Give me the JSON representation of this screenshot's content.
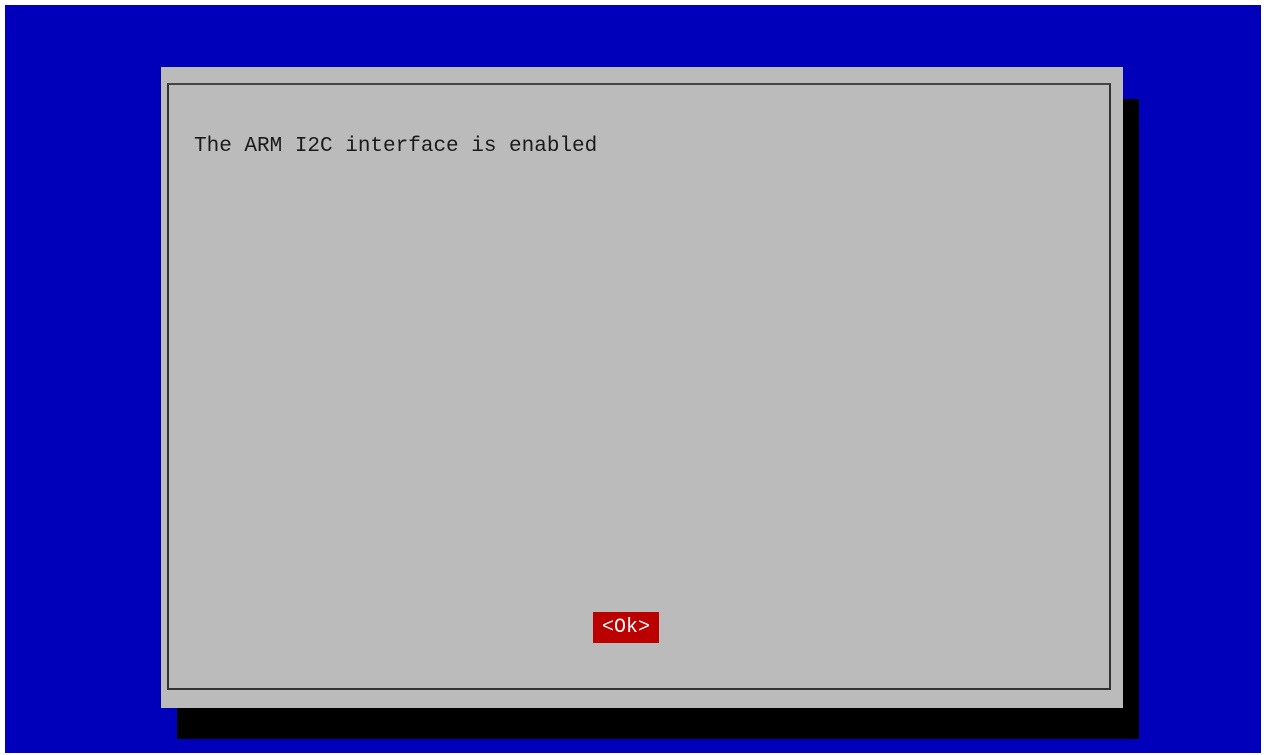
{
  "dialog": {
    "message": "The ARM I2C interface is enabled",
    "ok_label": "<Ok>"
  },
  "colors": {
    "background": "#0000bb",
    "dialog": "#bbbbbb",
    "shadow": "#000000",
    "button_focus": "#bb0000",
    "button_text": "#ffffff",
    "text": "#1a1a1a"
  }
}
